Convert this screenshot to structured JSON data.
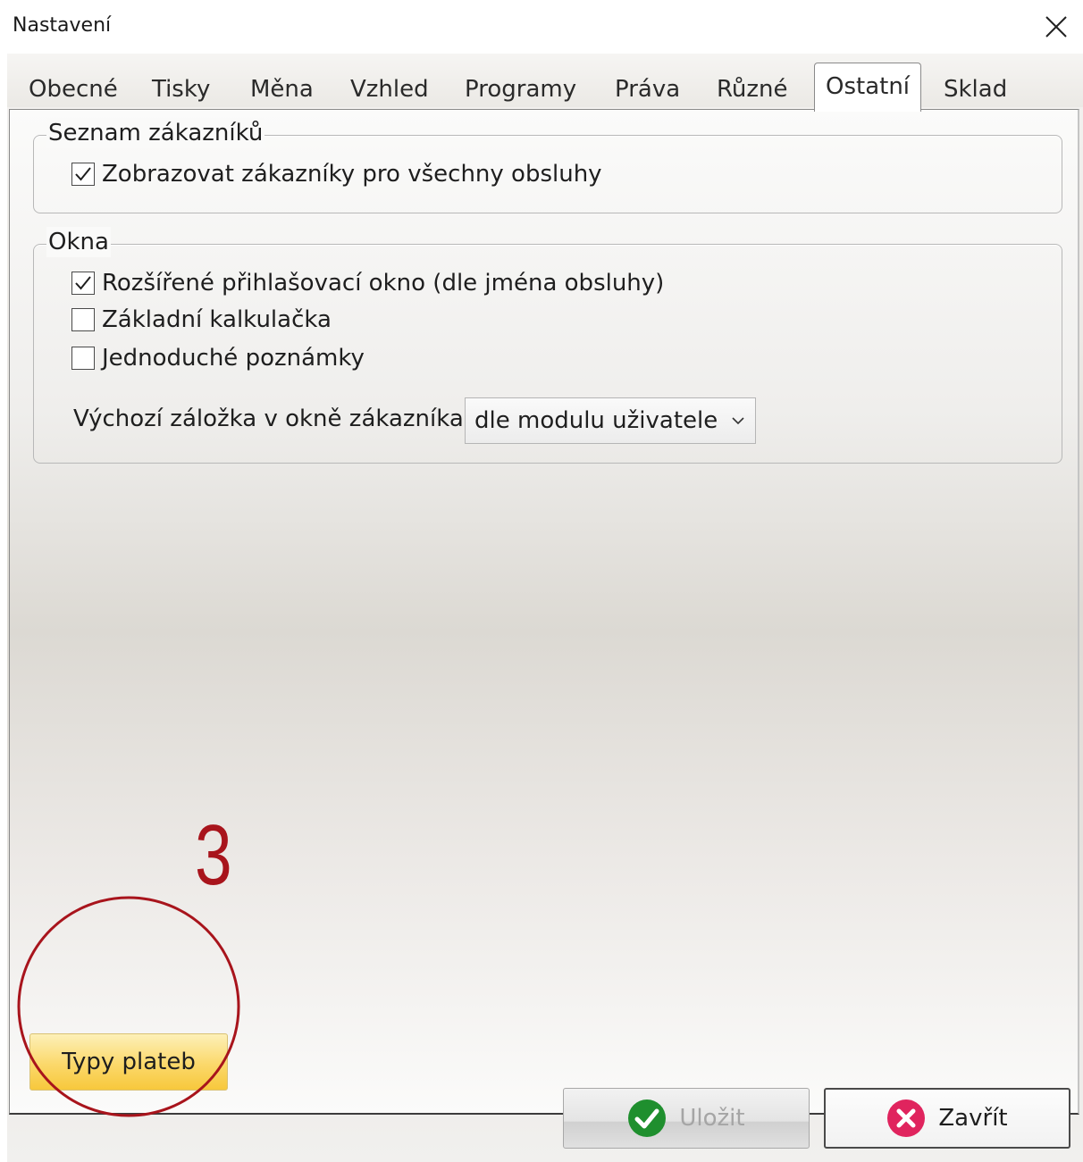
{
  "window": {
    "title": "Nastavení",
    "close_icon": "close-icon"
  },
  "tabs": [
    {
      "label": "Obecné",
      "active": false
    },
    {
      "label": "Tisky",
      "active": false
    },
    {
      "label": "Měna",
      "active": false
    },
    {
      "label": "Vzhled",
      "active": false
    },
    {
      "label": "Programy",
      "active": false
    },
    {
      "label": "Práva",
      "active": false
    },
    {
      "label": "Různé",
      "active": false
    },
    {
      "label": "Ostatní",
      "active": true
    },
    {
      "label": "Sklad",
      "active": false
    }
  ],
  "group_customers": {
    "legend": "Seznam zákazníků",
    "show_all_label": "Zobrazovat zákazníky pro všechny obsluhy",
    "show_all_checked": true
  },
  "group_windows": {
    "legend": "Okna",
    "extended_login_label": "Rozšířené přihlašovací okno (dle jména obsluhy)",
    "extended_login_checked": true,
    "basic_calc_label": "Základní kalkulačka",
    "basic_calc_checked": false,
    "simple_notes_label": "Jednoduché poznámky",
    "simple_notes_checked": false,
    "default_tab_label": "Výchozí záložka v okně zákazníka",
    "default_tab_value": "dle modulu uživatele"
  },
  "payment_types_button": "Typy plateb",
  "annotation": {
    "number": "3",
    "color": "#a8141c"
  },
  "footer": {
    "save_label": "Uložit",
    "save_enabled": false,
    "close_label": "Zavřít"
  },
  "colors": {
    "accent_yellow": "#f7c83c",
    "save_green": "#1f8f2e",
    "close_pink": "#e0245e"
  }
}
